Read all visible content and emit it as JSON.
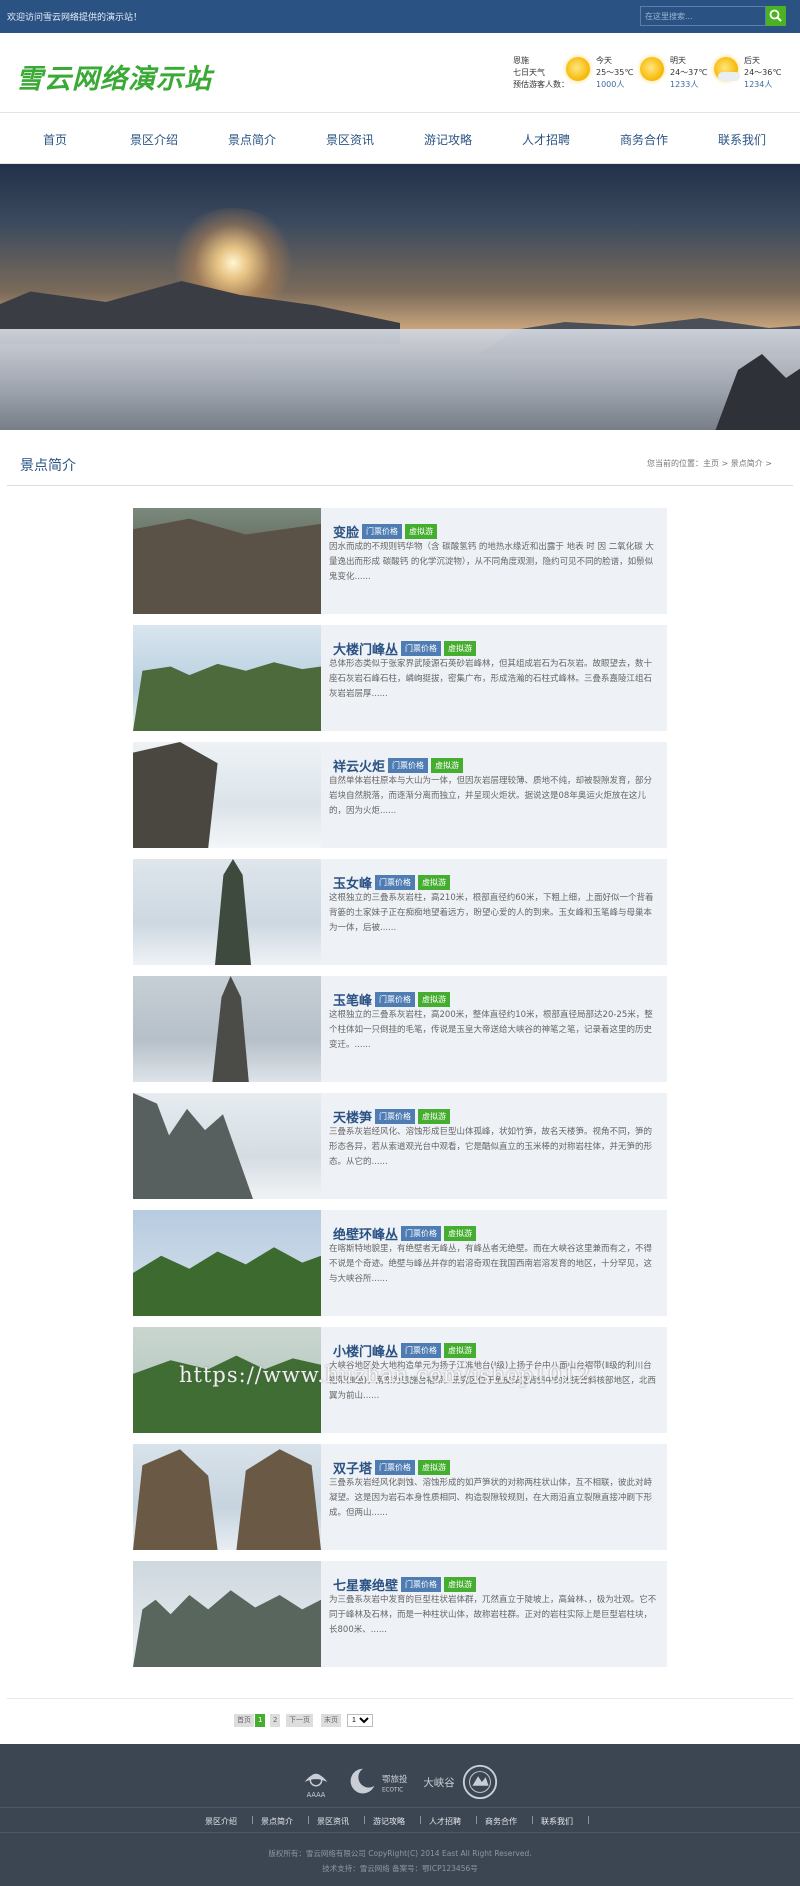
{
  "topbar": {
    "welcome": "欢迎访问雪云网络提供的演示站！",
    "search_placeholder": "在这里搜索..."
  },
  "header": {
    "logo": "雪云网络演示站",
    "weather": {
      "city": "恩施",
      "line2": "七日天气",
      "line3": "预估游客人数：",
      "days": [
        {
          "day": "今天",
          "temp": "25～35℃",
          "visitors": "1000人",
          "icon": "sun-icon"
        },
        {
          "day": "明天",
          "temp": "24～37℃",
          "visitors": "1233人",
          "icon": "sun-icon"
        },
        {
          "day": "后天",
          "temp": "24～36℃",
          "visitors": "1234人",
          "icon": "sun-cloud-icon"
        }
      ]
    }
  },
  "nav": [
    "首页",
    "景区介绍",
    "景点简介",
    "景区资讯",
    "游记攻略",
    "人才招聘",
    "商务合作",
    "联系我们"
  ],
  "page": {
    "title": "景点简介",
    "breadcrumb_prefix": "您当前的位置：",
    "breadcrumb_home": "主页",
    "breadcrumb_sep": ">",
    "breadcrumb_current": "景点简介",
    "breadcrumb_end": ">"
  },
  "tags": {
    "price": "门票价格",
    "virtual": "虚拟游"
  },
  "items": [
    {
      "name": "变脸",
      "desc": "因水而成的不规则钙华物（含 碳酸氢钙 的地热水缘近和出露于 地表 时 因 二氧化碳 大量逸出而形成 碳酸钙 的化学沉淀物），从不同角度观测，隐约可见不同的脸谱，如鬃似鬼变化......"
    },
    {
      "name": "大楼门峰丛",
      "desc": "总体形态类似于张家界武陵源石英砂岩峰林，但其组成岩石为石灰岩。故眼望去，数十座石灰岩石峰石柱，嶙峋挺拔，密集广布，形成浩瀚的石柱式峰林。三叠系嘉陵江组石灰岩岩层厚......"
    },
    {
      "name": "祥云火炬",
      "desc": "自然单体岩柱原本与大山为一体，但因灰岩层理较薄、质地不纯，却被裂隙发育，部分岩块自然脱落，而逐渐分离而独立，并呈现火炬状。据说这是08年奥运火炬放在这儿的，因为火炬......"
    },
    {
      "name": "玉女峰",
      "desc": "这根独立的三叠系灰岩柱，高210米，根部直径约60米，下粗上细，上面好似一个背着背篓的土家妹子正在痴痴地望着远方，盼望心爱的人的到来。玉女峰和玉笔峰与母巢本为一体，后被......"
    },
    {
      "name": "玉笔峰",
      "desc": "这根独立的三叠系灰岩柱，高200米，整体直径约10米，根部直径局部达20-25米，整个柱体如一只倒挂的毛笔，传说是玉皇大帝送给大峡谷的神笔之笔，记录着这里的历史变迁。......"
    },
    {
      "name": "天楼笋",
      "desc": "三叠系灰岩经风化、溶蚀形成巨型山体孤峰，状如竹笋，故名天楼笋。视角不同，笋的形态各异，若从索道观光台中观看，它是酷似直立的玉米棒的对称岩柱体，并无笋的形态。从它的......"
    },
    {
      "name": "绝壁环峰丛",
      "desc": "在喀斯特地貌里，有绝壁者无峰丛，有峰丛者无绝壁。而在大峡谷这里兼而有之，不得不说是个奇迹。绝壁与峰丛并存的岩溶奇观在我国西南岩溶发育的地区，十分罕见，这与大峡谷所......"
    },
    {
      "name": "小楼门峰丛",
      "desc": "大峡谷地区处大地构造单元为扬子江准地台(Ⅰ级)上扬子台中八面山台褶带(Ⅱ级的利川台褶带(Ⅲ级)，南东为恩施台褶带。研究区位于鱼皮泽复背斜中的沐抚背斜核部地区，北西翼为前山......"
    },
    {
      "name": "双子塔",
      "desc": "三叠系灰岩经风化剥蚀、溶蚀形成的如芦笋状的对称两柱状山体，互不相联，彼此对峙凝望。这是因为岩石本身性质相同、构造裂隙较规则，在大雨沿直立裂隙直接冲刷下形成。但两山......"
    },
    {
      "name": "七星寨绝壁",
      "desc": "为三叠系灰岩中发育的巨型柱状岩体群，兀然直立于陡坡上，高耸林、，极为壮观。它不同于峰林及石林，而是一种柱状山体，故称岩柱群。正对的岩柱实际上是巨型岩柱块，长800米、......"
    }
  ],
  "watermark": "https://www.huzhan.com/ishop1012",
  "pager": {
    "first": "首页",
    "p1": "1",
    "p2": "2",
    "next": "下一页",
    "last": "末页",
    "select": "1"
  },
  "footer": {
    "logo_texts": [
      "AAAA",
      "鄂旅投",
      "ECOTIC",
      "大峡谷"
    ],
    "links": [
      "景区介绍",
      "景点简介",
      "景区资讯",
      "游记攻略",
      "人才招聘",
      "商务合作",
      "联系我们"
    ],
    "link_sep": "|",
    "copyright": "版权所有：雪云网络有限公司 CopyRight(C) 2014 East All Right Reserved.",
    "support": "技术支持：雪云网络 备案号：鄂ICP123456号"
  }
}
